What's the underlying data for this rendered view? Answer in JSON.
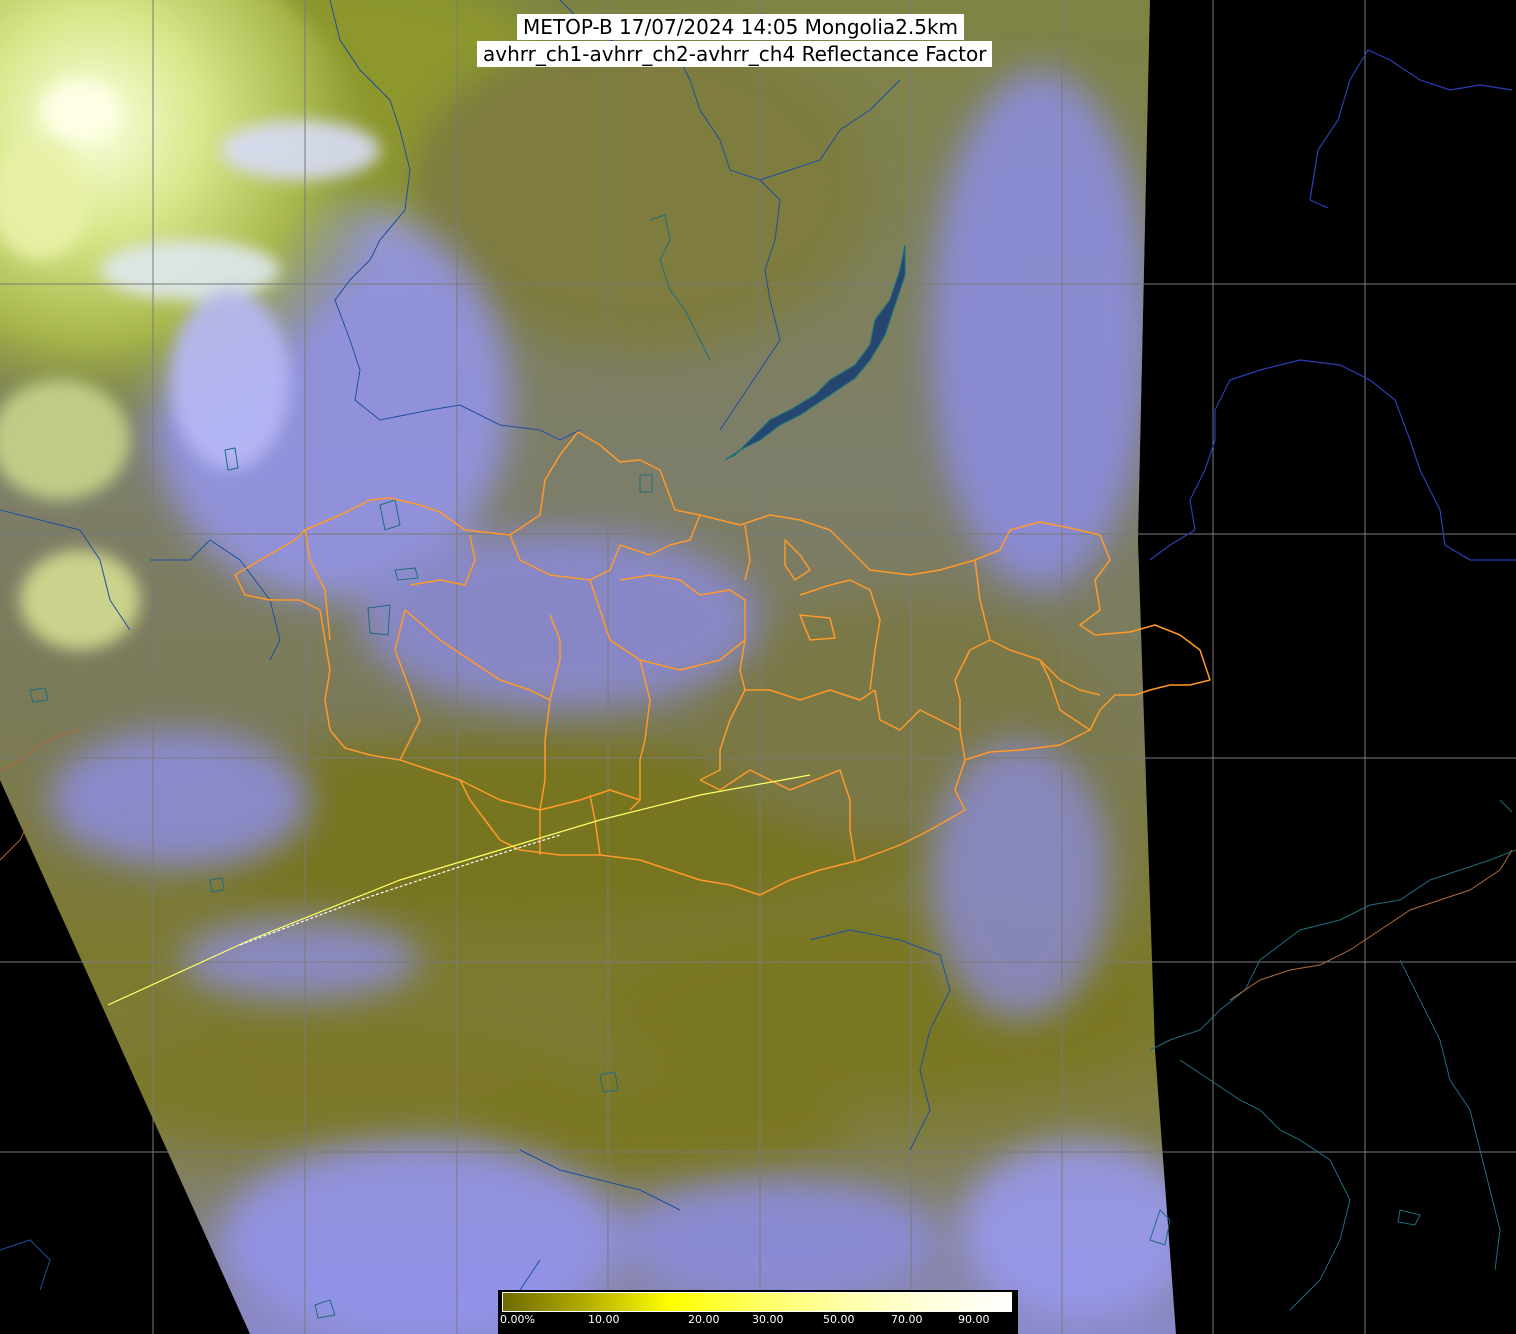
{
  "title": {
    "line1": "METOP-B 17/07/2024 14:05 Mongolia2.5km",
    "line2": "avhrr_ch1-avhrr_ch2-avhrr_ch4 Reflectance Factor"
  },
  "colorbar": {
    "labels": [
      "0.00%",
      "10.00",
      "20.00",
      "30.00",
      "50.00",
      "70.00",
      "90.00"
    ],
    "colors": [
      "#6e6a00",
      "#b7b000",
      "#ffff00",
      "#ffff60",
      "#ffffa8",
      "#ffffd8",
      "#ffffff"
    ]
  },
  "colors": {
    "background": "#000000",
    "grid": "#7a7a7a",
    "coast": "#2a3fb5",
    "rivers": "#1d5c8a",
    "mongolia_boundaries": "#ff9a2a",
    "international_border": "#b06a3a",
    "cloud_blue": "#8c8cf0",
    "ground_olive": "#7f7c2e",
    "bright_cloud": "#f4f8c0"
  }
}
